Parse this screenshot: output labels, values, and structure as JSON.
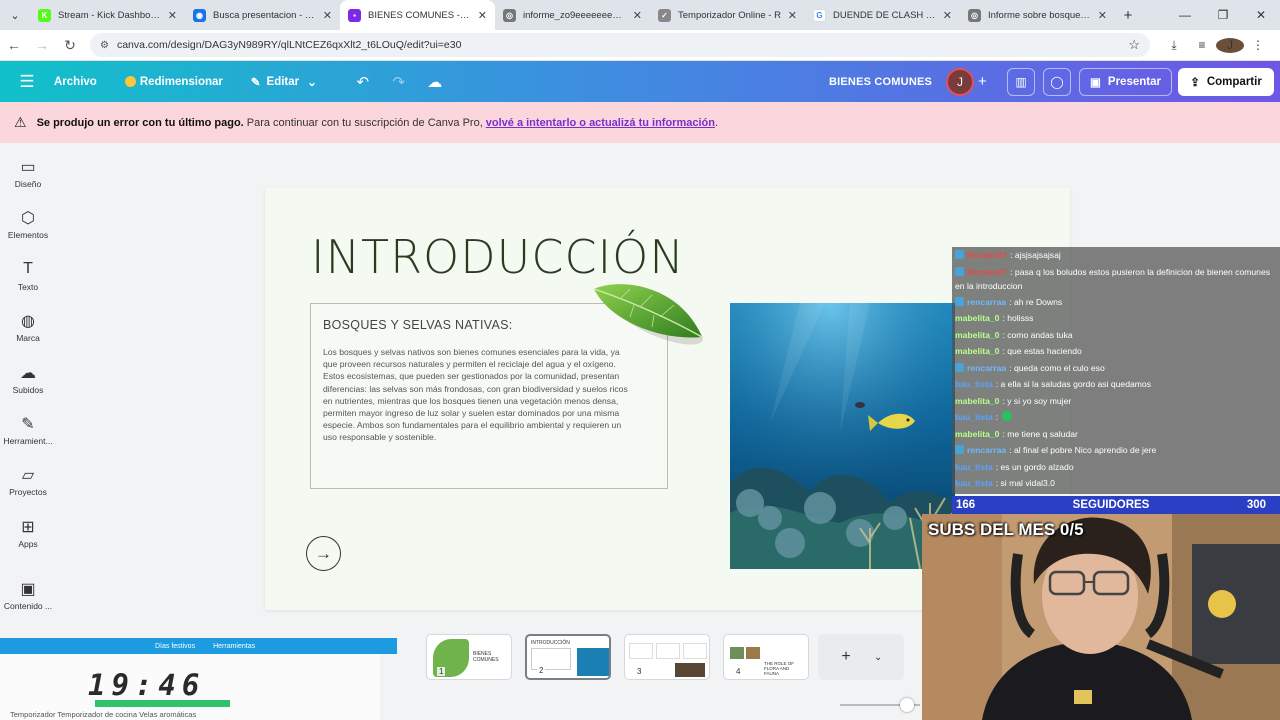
{
  "browser": {
    "tabs": [
      {
        "title": "Stream - Kick Dashboard",
        "color": "#53fc18",
        "glyph": "K"
      },
      {
        "title": "Busca presentacion - Ca",
        "color": "#1a73e8",
        "glyph": "◉"
      },
      {
        "title": "BIENES COMUNES - Pres",
        "color": "#7d2ae8",
        "glyph": "▪",
        "active": true
      },
      {
        "title": "informe_zo9eeeeeeeeee",
        "color": "#777777",
        "glyph": "◎"
      },
      {
        "title": "Temporizador Online - R",
        "color": "#888888",
        "glyph": "✓"
      },
      {
        "title": "DUENDE DE CLASH ROYA",
        "color": "#ffffff",
        "glyph": "G"
      },
      {
        "title": "Informe sobre bosques y",
        "color": "#777777",
        "glyph": "◎"
      }
    ],
    "url": "canva.com/design/DAG3yN989RY/qlLNtCEZ6qxXlt2_t6LOuQ/edit?ui=e30",
    "profile_initial": "J"
  },
  "header": {
    "archivo": "Archivo",
    "redimensionar": "Redimensionar",
    "editar": "Editar",
    "design_title": "BIENES COMUNES",
    "avatar_initial": "J",
    "presentar": "Presentar",
    "compartir": "Compartir"
  },
  "banner": {
    "bold": "Se produjo un error con tu último pago.",
    "text": "Para continuar con tu suscripción de Canva Pro,",
    "link": "volvé a intentarlo o actualizá tu información",
    "end": "."
  },
  "sidebar": {
    "items": [
      {
        "label": "Diseño",
        "icon": "layout-icon",
        "glyph": "▭"
      },
      {
        "label": "Elementos",
        "icon": "shapes-icon",
        "glyph": "⬡"
      },
      {
        "label": "Texto",
        "icon": "text-icon",
        "glyph": "T"
      },
      {
        "label": "Marca",
        "icon": "brand-icon",
        "glyph": "◍"
      },
      {
        "label": "Subidos",
        "icon": "upload-cloud-icon",
        "glyph": "☁"
      },
      {
        "label": "Herramient...",
        "icon": "tools-icon",
        "glyph": "✎"
      },
      {
        "label": "Proyectos",
        "icon": "folder-icon",
        "glyph": "▱"
      },
      {
        "label": "Apps",
        "icon": "apps-icon",
        "glyph": "⊞"
      },
      {
        "label": "Contenido ...",
        "icon": "content-icon",
        "glyph": "▣"
      }
    ]
  },
  "slide": {
    "title": "INTRODUCCIÓN",
    "box_heading": "BOSQUES Y SELVAS NATIVAS:",
    "box_body": "Los bosques y selvas nativos son bienes comunes esenciales para la vida, ya que proveen recursos naturales y permiten el reciclaje del agua y el oxígeno. Estos ecosistemas, que pueden ser gestionados por la comunidad, presentan diferencias: las selvas son más frondosas, con gran biodiversidad y suelos ricos en nutrientes, mientras que los bosques tienen una vegetación menos densa, permiten mayor ingreso de luz solar y suelen estar dominados por una misma especie. Ambos son fundamentales para el equilibrio ambiental y requieren un uso responsable y sostenible."
  },
  "thumbnails": [
    {
      "num": "1",
      "caption": "BIENES COMUNES"
    },
    {
      "num": "2",
      "caption": "INTRODUCCIÓN"
    },
    {
      "num": "3",
      "caption": ""
    },
    {
      "num": "4",
      "caption": "THE ROLE OF FLORA AND FAUNA"
    }
  ],
  "timer": {
    "menu1": "Días festivos",
    "menu2": "Herramientas",
    "time": "19:46",
    "links": "Temporizador    Temporizador de cocina    Velas aromáticas"
  },
  "chat": {
    "messages": [
      {
        "user": "Nicolas07",
        "text": ": ajsjsajsajsaj",
        "badge": true,
        "ucolor": "#e24a4a"
      },
      {
        "user": "Nicolas07",
        "text": ": pasa q los boludos estos pusieron la definicion de bienen comunes en la introduccion",
        "badge": true,
        "ucolor": "#e24a4a",
        "wrap": true
      },
      {
        "user": "rencarraa",
        "text": ": ah re Downs",
        "badge": true,
        "ucolor": "#6fb7ff"
      },
      {
        "user": "mabelita_0",
        "text": ": holisss",
        "badge": false,
        "ucolor": "#b6ff8a"
      },
      {
        "user": "mabelita_0",
        "text": ": como andas tuka",
        "badge": false,
        "ucolor": "#b6ff8a"
      },
      {
        "user": "mabelita_0",
        "text": ": que estas haciendo",
        "badge": false,
        "ucolor": "#b6ff8a"
      },
      {
        "user": "rencarraa",
        "text": ": queda como el culo eso",
        "badge": true,
        "ucolor": "#6fb7ff"
      },
      {
        "user": "bau_tista",
        "text": ": a ella si la saludas gordo asi quedamos",
        "badge": false,
        "ucolor": "#5aa2ff"
      },
      {
        "user": "mabelita_0",
        "text": ": y si yo soy mujer",
        "badge": false,
        "ucolor": "#b6ff8a"
      },
      {
        "user": "bau_tista",
        "text": ":",
        "badge": false,
        "ucolor": "#5aa2ff",
        "emote": true
      },
      {
        "user": "mabelita_0",
        "text": ": me tiene q saludar",
        "badge": false,
        "ucolor": "#b6ff8a"
      },
      {
        "user": "rencarraa",
        "text": ": al final el pobre Nico aprendio de jere",
        "badge": true,
        "ucolor": "#6fb7ff"
      },
      {
        "user": "bau_tista",
        "text": ": es un gordo alzado",
        "badge": false,
        "ucolor": "#5aa2ff"
      },
      {
        "user": "bau_tista",
        "text": ": si mal vidal3.0",
        "badge": false,
        "ucolor": "#5aa2ff"
      }
    ]
  },
  "followers": {
    "current": "166",
    "label": "SEGUIDORES",
    "goal": "300"
  },
  "webcam": {
    "subs": "SUBS DEL MES 0/5"
  }
}
